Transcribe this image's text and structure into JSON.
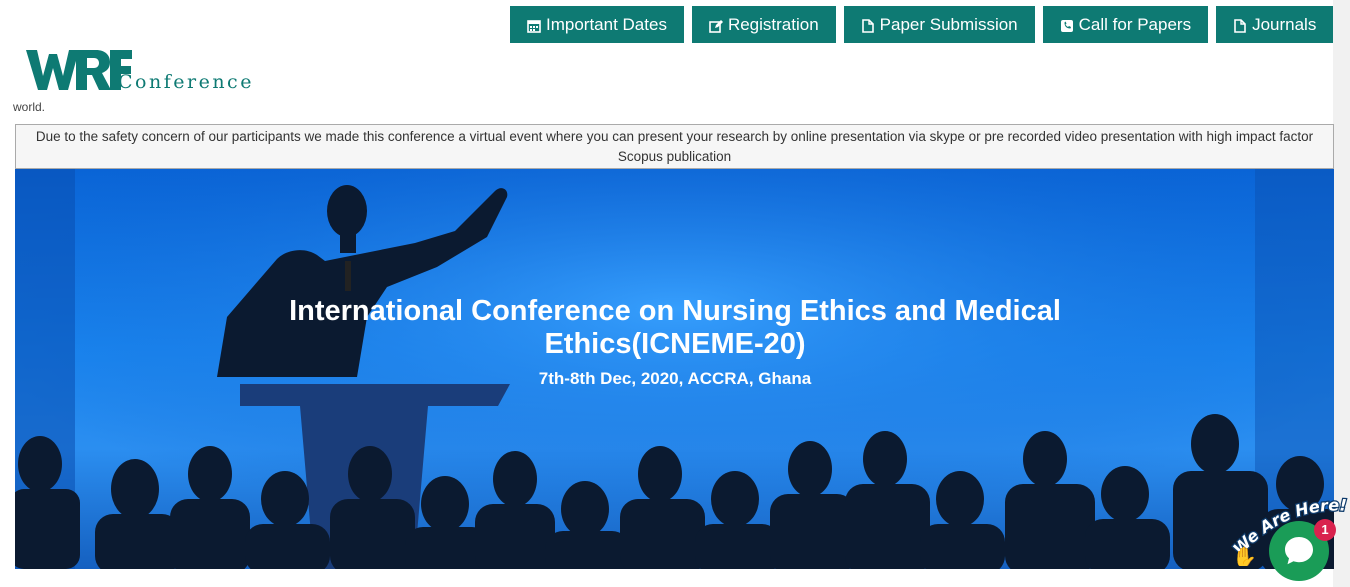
{
  "nav": {
    "buttons": [
      {
        "label": "Important Dates",
        "icon": "calendar-icon"
      },
      {
        "label": "Registration",
        "icon": "edit-icon"
      },
      {
        "label": "Paper Submission",
        "icon": "file-icon"
      },
      {
        "label": "Call for Papers",
        "icon": "phone-icon"
      },
      {
        "label": "Journals",
        "icon": "file-icon"
      }
    ]
  },
  "logo": {
    "mark": "WRF",
    "word": "Conference",
    "color": "#0e7a73"
  },
  "fragment_text": "world.",
  "notice": "Due to the safety concern of our participants we made this conference a virtual event where you can present your research by online presentation via skype or pre recorded video presentation with high impact factor Scopus publication",
  "hero": {
    "title": "International Conference on Nursing Ethics and Medical Ethics(ICNEME-20)",
    "date": "7th-8th Dec, 2020, ACCRA, Ghana"
  },
  "chat": {
    "label": "We Are Here!",
    "badge": "1",
    "color": "#1a9c57"
  }
}
